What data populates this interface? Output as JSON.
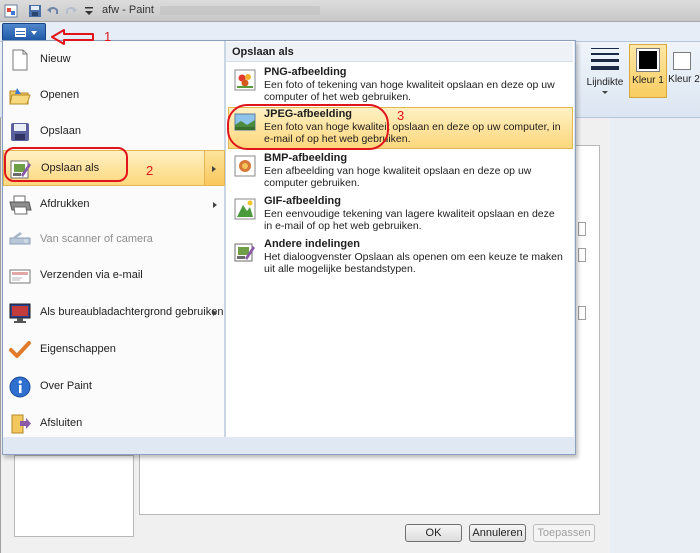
{
  "titlebar": {
    "title": "afw - Paint",
    "qat_icons": [
      "paint-icon",
      "save-icon",
      "undo-icon",
      "redo-icon",
      "customize-dropdown-icon"
    ]
  },
  "ribbon": {
    "lijndikte_label": "Lijndikte",
    "kleur1_label": "Kleur 1",
    "kleur2_label": "Kleur 2"
  },
  "menu": {
    "items": [
      {
        "label": "Nieuw",
        "icon": "new-document-icon"
      },
      {
        "label": "Openen",
        "icon": "open-folder-icon"
      },
      {
        "label": "Opslaan",
        "icon": "save-icon"
      },
      {
        "label": "Opslaan als",
        "icon": "save-as-icon",
        "selected": true
      },
      {
        "label": "Afdrukken",
        "icon": "printer-icon"
      },
      {
        "label": "Van scanner of camera",
        "icon": "scanner-icon",
        "disabled": true
      },
      {
        "label": "Verzenden via e-mail",
        "icon": "email-icon"
      },
      {
        "label": "Als bureaubladachtergrond gebruiken",
        "icon": "desktop-background-icon"
      },
      {
        "label": "Eigenschappen",
        "icon": "checkmark-icon"
      },
      {
        "label": "Over Paint",
        "icon": "info-icon"
      },
      {
        "label": "Afsluiten",
        "icon": "exit-icon"
      }
    ]
  },
  "submenu": {
    "header": "Opslaan als",
    "items": [
      {
        "title": "PNG-afbeelding",
        "desc": "Een foto of tekening van hoge kwaliteit opslaan en deze op uw computer of het web gebruiken.",
        "icon": "png-image-icon"
      },
      {
        "title": "JPEG-afbeelding",
        "desc": "Een foto van hoge kwaliteit opslaan en deze op uw computer, in e-mail of op het web gebruiken.",
        "icon": "jpeg-image-icon",
        "selected": true
      },
      {
        "title": "BMP-afbeelding",
        "desc": "Een afbeelding van hoge kwaliteit opslaan en deze op uw computer gebruiken.",
        "icon": "bmp-image-icon"
      },
      {
        "title": "GIF-afbeelding",
        "desc": "Een eenvoudige tekening van lagere kwaliteit opslaan en deze in e-mail of op het web gebruiken.",
        "icon": "gif-image-icon"
      },
      {
        "title": "Andere indelingen",
        "desc": "Het dialoogvenster Opslaan als openen om een keuze te maken uit alle mogelijke bestandstypen.",
        "icon": "other-formats-icon"
      }
    ]
  },
  "dialog_buttons": {
    "ok": "OK",
    "cancel": "Annuleren",
    "apply": "Toepassen"
  },
  "annotations": {
    "one": "1",
    "two": "2",
    "three": "3",
    "color": "#e0151b"
  },
  "colors": {
    "highlight": "#fdd77c",
    "ribbon": "#dce6f2",
    "app_button": "#1f5aa8"
  }
}
